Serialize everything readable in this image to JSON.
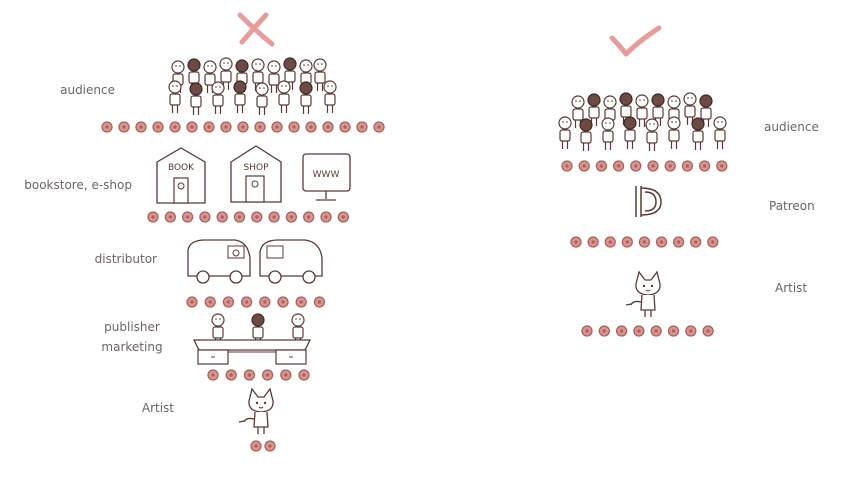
{
  "colors": {
    "ink": "#5a3a36",
    "dot_fill": "#d9948f",
    "dot_stroke": "#a8615b",
    "cross": "#e79c99",
    "check": "#e79c99",
    "text": "#6d6464"
  },
  "left_side": {
    "marker": "cross-icon",
    "levels": [
      {
        "label": "audience"
      },
      {
        "label": "bookstore, e-shop",
        "signs": [
          "BOOK",
          "SHOP",
          "WWW"
        ]
      },
      {
        "label": "distributor"
      },
      {
        "label": "publisher",
        "label2": "marketing"
      },
      {
        "label": "Artist"
      }
    ]
  },
  "right_side": {
    "marker": "check-icon",
    "levels": [
      {
        "label": "audience"
      },
      {
        "label": "Patreon"
      },
      {
        "label": "Artist"
      }
    ]
  }
}
